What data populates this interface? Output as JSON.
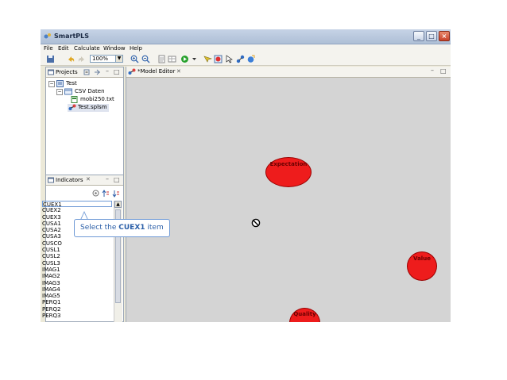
{
  "window": {
    "title": "SmartPLS"
  },
  "menu": [
    "File",
    "Edit",
    "Calculate",
    "Window",
    "Help"
  ],
  "toolbar": {
    "zoom_value": "100%"
  },
  "projects_panel": {
    "tab_label": "Projects",
    "tree": {
      "root": "Test",
      "folder": "CSV Daten",
      "data_file": "mobi250.txt",
      "model_file": "Test.splsm"
    }
  },
  "indicators_panel": {
    "tab_label": "Indicators",
    "items": [
      "CUEX1",
      "CUEX2",
      "CUEX3",
      "CUSA1",
      "CUSA2",
      "CUSA3",
      "CUSCO",
      "CUSL1",
      "CUSL2",
      "CUSL3",
      "IMAG1",
      "IMAG2",
      "IMAG3",
      "IMAG4",
      "IMAG5",
      "PERQ1",
      "PERQ2",
      "PERQ3"
    ],
    "selected_index": 0
  },
  "editor": {
    "tab_label": "*Model Editor",
    "nodes": {
      "expectation": "Expectation",
      "value": "Value",
      "quality": "Quality"
    }
  },
  "callout": {
    "prefix": "Select the ",
    "item": "CUEX1",
    "suffix": " item"
  },
  "colors": {
    "construct": "#ee1c1c",
    "callout_border": "#6f9ad6",
    "canvas": "#d4d4d4"
  }
}
